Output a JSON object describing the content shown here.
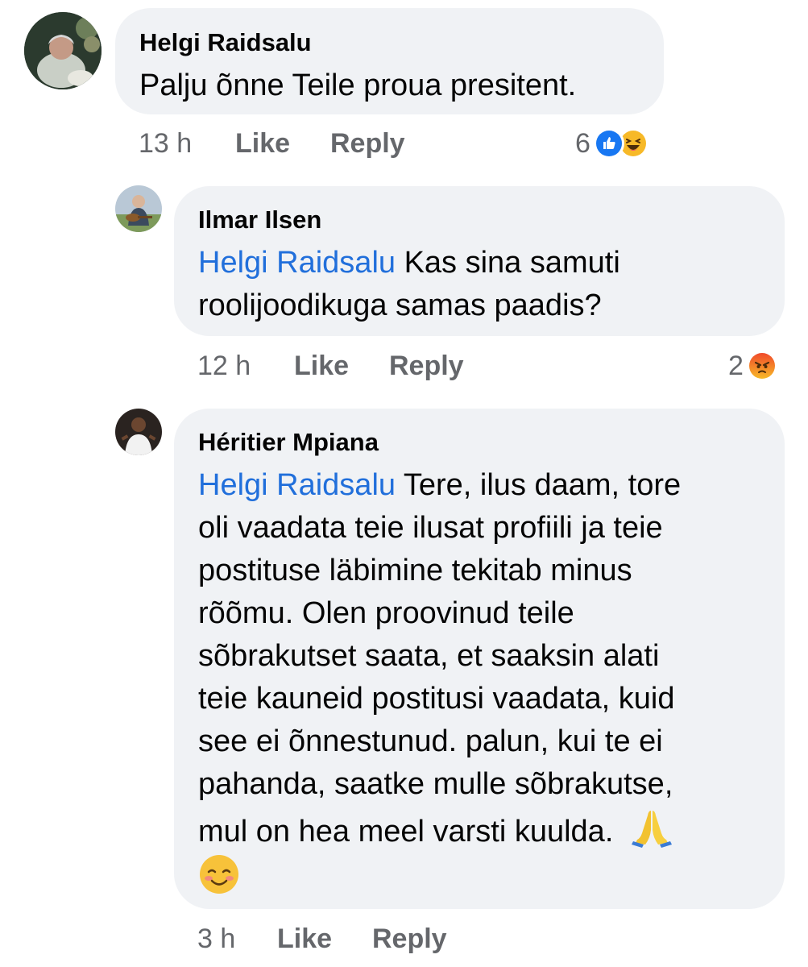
{
  "comments": [
    {
      "author": "Helgi Raidsalu",
      "text": "Palju õnne Teile proua presitent.",
      "time": "13 h",
      "like_label": "Like",
      "reply_label": "Reply",
      "reaction_count": "6",
      "reactions": [
        "like-icon",
        "haha-icon"
      ]
    },
    {
      "author": "Ilmar Ilsen",
      "mention": "Helgi Raidsalu",
      "text_line1": " Kas sina samuti",
      "text_line2": "roolijoodikuga samas paadis?",
      "time": "12 h",
      "like_label": "Like",
      "reply_label": "Reply",
      "reaction_count": "2",
      "reactions": [
        "angry-icon"
      ]
    },
    {
      "author": "Héritier Mpiana",
      "mention": "Helgi Raidsalu",
      "lines": [
        " Tere, ilus daam, tore",
        "oli vaadata teie ilusat profiili ja teie",
        "postituse läbimine tekitab minus",
        "rõõmu.  Olen proovinud teile",
        "sõbrakutset saata, et saaksin alati",
        "teie kauneid postitusi vaadata, kuid",
        "see ei õnnestunud.  palun, kui te ei",
        "pahanda, saatke mulle sõbrakutse,",
        "mul on hea meel varsti kuulda.  "
      ],
      "emojis": [
        "folded-hands-emoji",
        "smiling-face-emoji"
      ],
      "time": "3 h",
      "like_label": "Like",
      "reply_label": "Reply"
    }
  ],
  "colors": {
    "bubble": "#f0f2f5",
    "mention": "#216fdb",
    "meta": "#65676b",
    "like_blue": "#1877f2",
    "haha_yellow": "#f7b928",
    "angry_red": "#e9710f"
  }
}
